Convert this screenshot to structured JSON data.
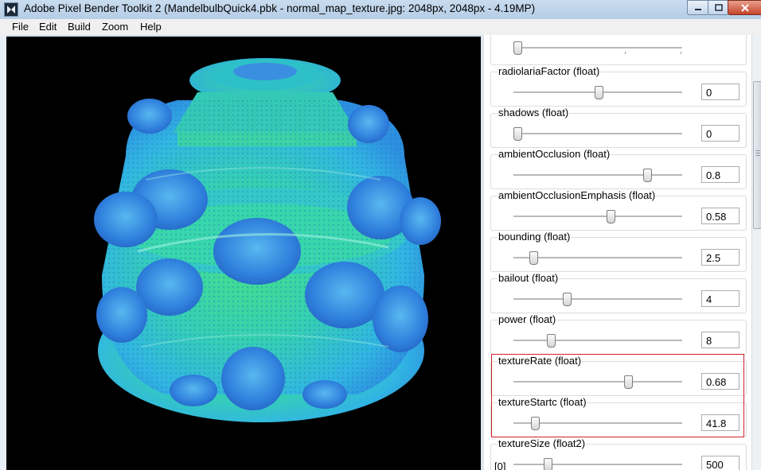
{
  "window": {
    "title": "Adobe Pixel Bender Toolkit 2 (MandelbulbQuick4.pbk - normal_map_texture.jpg: 2048px, 2048px - 4.19MP)"
  },
  "menu": {
    "items": [
      "File",
      "Edit",
      "Build",
      "Zoom",
      "Help"
    ]
  },
  "image": {
    "subject": "mandelbulb fractal render",
    "background_color": "#000000"
  },
  "params": [
    {
      "label": "",
      "value": "",
      "level": 0.0
    },
    {
      "label": "radiolariaFactor (float)",
      "value": "0",
      "level": 0.5
    },
    {
      "label": "shadows (float)",
      "value": "0",
      "level": 0.0
    },
    {
      "label": "ambientOcclusion (float)",
      "value": "0.8",
      "level": 0.8
    },
    {
      "label": "ambientOcclusionEmphasis (float)",
      "value": "0.58",
      "level": 0.58
    },
    {
      "label": "bounding (float)",
      "value": "2.5",
      "level": 0.125
    },
    {
      "label": "bailout (float)",
      "value": "4",
      "level": 0.32
    },
    {
      "label": "power (float)",
      "value": "8",
      "level": 0.22
    },
    {
      "label": "textureRate (float)",
      "value": "0.68",
      "level": 0.68
    },
    {
      "label": "textureStartc (float)",
      "value": "41.8",
      "level": 0.13
    },
    {
      "label": "textureSize (float2)",
      "value": "500",
      "level": 0.2,
      "index_label": "[0]"
    }
  ],
  "colors": {
    "highlight": "#d0202a",
    "fractal_primary": "#2fc7d6",
    "fractal_secondary": "#3a8fe0",
    "fractal_tertiary": "#3fe08f"
  }
}
